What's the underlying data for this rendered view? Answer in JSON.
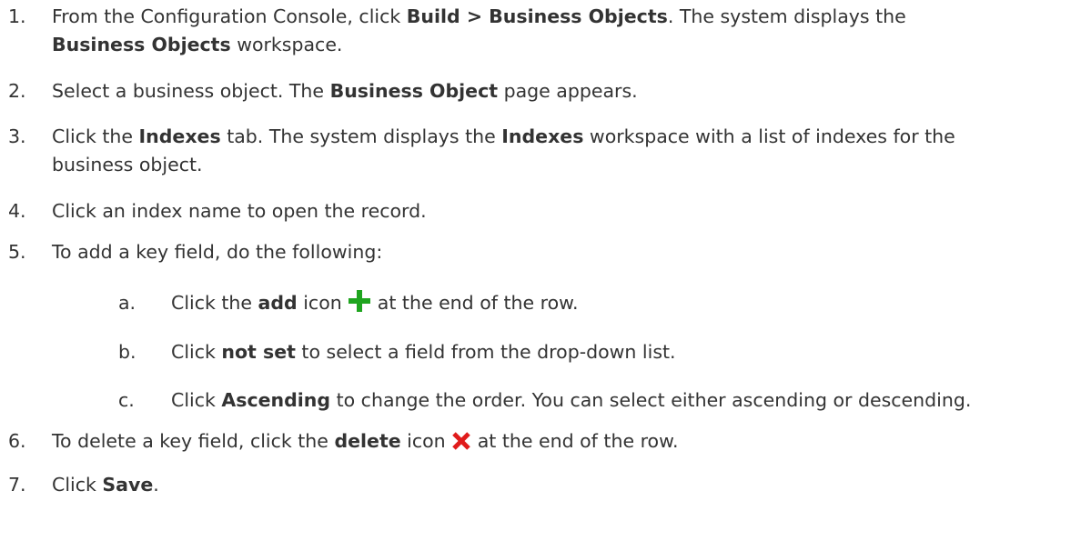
{
  "steps": [
    {
      "num": "1.",
      "pre": "From the Configuration Console, click ",
      "bold1": "Build > Business Objects",
      "post": ". The system displays the",
      "line2_bold": "Business Objects",
      "line2_post": " workspace."
    },
    {
      "num": "2.",
      "pre": "Select a business object. The ",
      "bold1": "Business Object",
      "post": " page appears."
    },
    {
      "num": "3.",
      "pre": "Click the ",
      "bold1": "Indexes",
      "mid": " tab. The system displays the ",
      "bold2": "Indexes",
      "post": " workspace with a list of indexes for the",
      "line2_post": "business object."
    },
    {
      "num": "4.",
      "text": "Click an index name to open the record."
    },
    {
      "num": "5.",
      "text": "To add a key field, do the following:"
    },
    {
      "num": "6.",
      "pre": "To delete a key field, click the ",
      "bold1": "delete",
      "mid": " icon",
      "post": " at the end of the row.",
      "icon": "delete-x-icon"
    },
    {
      "num": "7.",
      "pre": "Click ",
      "bold1": "Save",
      "post": "."
    }
  ],
  "substeps": [
    {
      "letter": "a.",
      "pre": "Click the ",
      "bold1": "add",
      "mid": " icon",
      "post": " at the end of the row.",
      "icon": "add-plus-icon"
    },
    {
      "letter": "b.",
      "pre": "Click ",
      "bold1": "not set",
      "post": " to select a field from the drop-down list."
    },
    {
      "letter": "c.",
      "pre": "Click ",
      "bold1": "Ascending",
      "post": " to change the order. You can select either ascending or descending."
    }
  ],
  "colors": {
    "text": "#333333",
    "add_icon": "#1fa51f",
    "delete_icon": "#e01b1b"
  }
}
